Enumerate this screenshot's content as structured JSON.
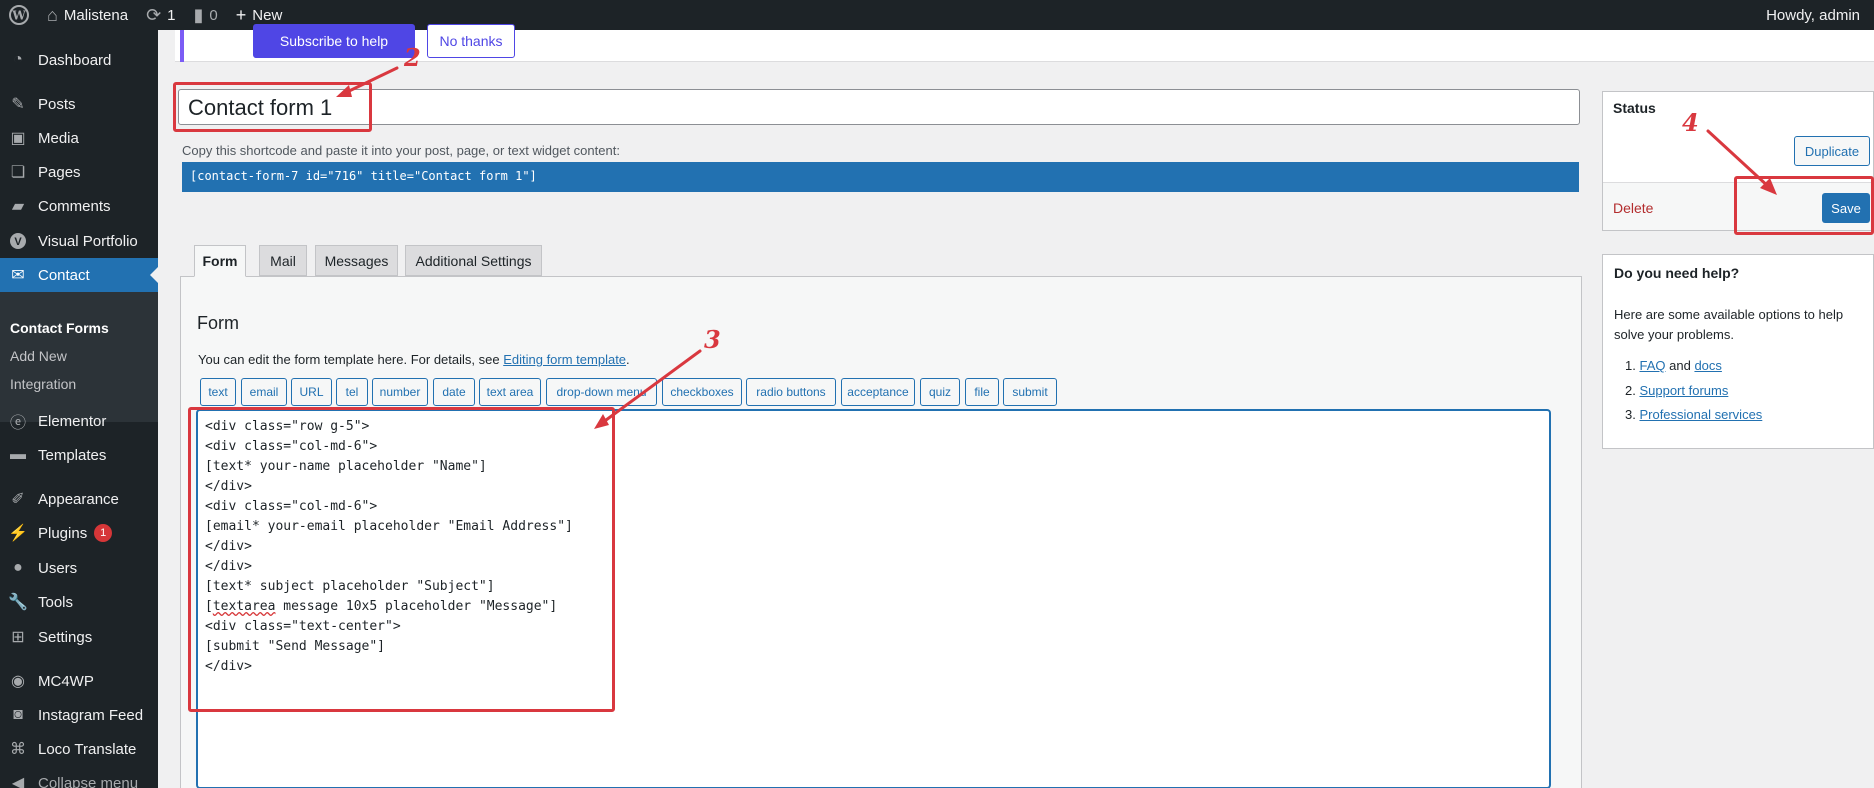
{
  "adminbar": {
    "site_name": "Malistena",
    "updates_count": "1",
    "comments_count": "0",
    "new_label": "New",
    "howdy": "Howdy, admin"
  },
  "sidebar": {
    "items": [
      {
        "label": "Dashboard",
        "icon": "dashboard-icon"
      },
      {
        "label": "Posts",
        "icon": "pin-icon"
      },
      {
        "label": "Media",
        "icon": "media-icon"
      },
      {
        "label": "Pages",
        "icon": "pages-icon"
      },
      {
        "label": "Comments",
        "icon": "comment-icon"
      },
      {
        "label": "Visual Portfolio",
        "icon": "v-icon"
      },
      {
        "label": "Contact",
        "icon": "mail-icon"
      },
      {
        "label": "Elementor",
        "icon": "elementor-icon"
      },
      {
        "label": "Templates",
        "icon": "folder-icon"
      },
      {
        "label": "Appearance",
        "icon": "brush-icon"
      },
      {
        "label": "Plugins",
        "icon": "plug-icon"
      },
      {
        "label": "Users",
        "icon": "user-icon"
      },
      {
        "label": "Tools",
        "icon": "wrench-icon"
      },
      {
        "label": "Settings",
        "icon": "settings-icon"
      },
      {
        "label": "MC4WP",
        "icon": "mc4wp-icon"
      },
      {
        "label": "Instagram Feed",
        "icon": "camera-icon"
      },
      {
        "label": "Loco Translate",
        "icon": "translate-icon"
      },
      {
        "label": "Collapse menu",
        "icon": "collapse-icon"
      }
    ],
    "plugins_badge": "1",
    "submenu": [
      "Contact Forms",
      "Add New",
      "Integration"
    ]
  },
  "notice": {
    "primary_button": "Subscribe to help",
    "secondary_button": "No thanks"
  },
  "editor": {
    "title_value": "Contact form 1",
    "shortcode_label": "Copy this shortcode and paste it into your post, page, or text widget content:",
    "shortcode": "[contact-form-7 id=\"716\" title=\"Contact form 1\"]",
    "tabs": [
      "Form",
      "Mail",
      "Messages",
      "Additional Settings"
    ],
    "form_heading": "Form",
    "form_desc_prefix": "You can edit the form template here. For details, see ",
    "form_desc_link": "Editing form template",
    "form_desc_suffix": ".",
    "tag_buttons": [
      "text",
      "email",
      "URL",
      "tel",
      "number",
      "date",
      "text area",
      "drop-down menu",
      "checkboxes",
      "radio buttons",
      "acceptance",
      "quiz",
      "file",
      "submit"
    ],
    "code_lines": [
      "<div class=\"row g-5\">",
      "<div class=\"col-md-6\">",
      "[text* your-name placeholder \"Name\"]",
      "</div>",
      "<div class=\"col-md-6\">",
      "[email* your-email placeholder \"Email Address\"]",
      "</div>",
      "</div>",
      "[text* subject placeholder \"Subject\"]",
      "[textarea message 10x5 placeholder \"Message\"]",
      "<div class=\"text-center\">",
      "[submit \"Send Message\"]",
      "</div>"
    ]
  },
  "status": {
    "title": "Status",
    "duplicate": "Duplicate",
    "delete": "Delete",
    "save": "Save"
  },
  "help": {
    "title": "Do you need help?",
    "desc": "Here are some available options to help solve your problems.",
    "item1_num": "1.",
    "item1_link_a": "FAQ",
    "item1_and": "and",
    "item1_link_b": "docs",
    "item2_num": "2.",
    "item2_link": "Support forums",
    "item3_num": "3.",
    "item3_link": "Professional services"
  },
  "annotations": [
    "2",
    "3",
    "4"
  ],
  "colors": {
    "wp_blue": "#2271b1",
    "annotation_red": "#d9383f",
    "adminbar_bg": "#1d2327"
  }
}
